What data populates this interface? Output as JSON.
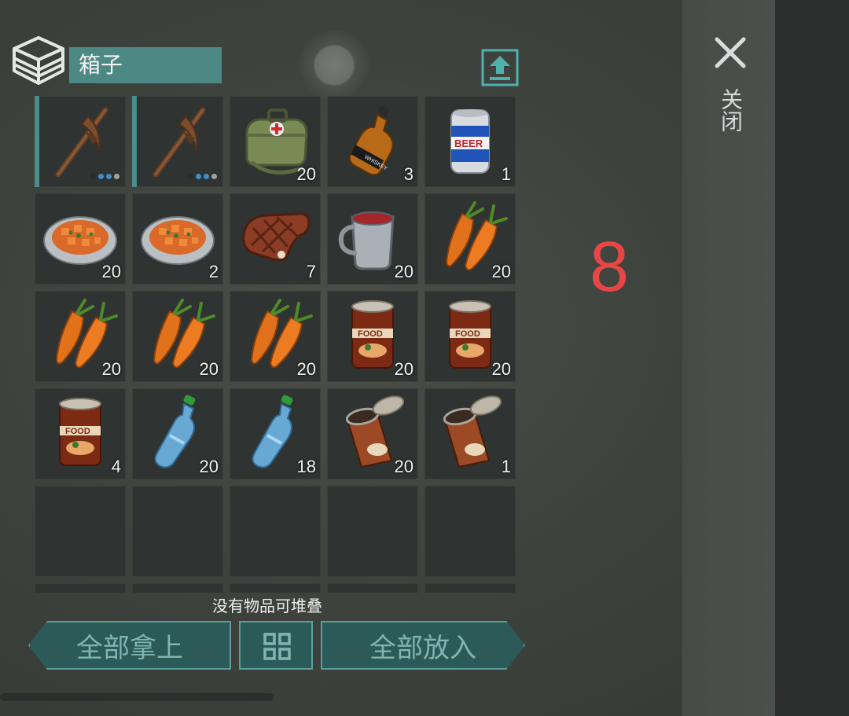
{
  "header": {
    "title": "箱子"
  },
  "close": {
    "label": "关闭"
  },
  "overlay_number": "8",
  "inventory": {
    "slots": [
      {
        "icon": "pickaxe",
        "count": "",
        "durability": 3
      },
      {
        "icon": "pickaxe",
        "count": "",
        "durability": 3
      },
      {
        "icon": "medkit-bag",
        "count": "20"
      },
      {
        "icon": "whiskey-bottle",
        "count": "3"
      },
      {
        "icon": "beer-can",
        "count": "1"
      },
      {
        "icon": "carrot-stew-plate",
        "count": "20"
      },
      {
        "icon": "carrot-stew-plate",
        "count": "2"
      },
      {
        "icon": "steak",
        "count": "7"
      },
      {
        "icon": "tea-mug",
        "count": "20"
      },
      {
        "icon": "carrots",
        "count": "20"
      },
      {
        "icon": "carrots",
        "count": "20"
      },
      {
        "icon": "carrots",
        "count": "20"
      },
      {
        "icon": "carrots",
        "count": "20"
      },
      {
        "icon": "canned-food",
        "count": "20"
      },
      {
        "icon": "canned-food",
        "count": "20"
      },
      {
        "icon": "canned-food",
        "count": "4"
      },
      {
        "icon": "water-bottle",
        "count": "20"
      },
      {
        "icon": "water-bottle",
        "count": "18"
      },
      {
        "icon": "open-can",
        "count": "20"
      },
      {
        "icon": "open-can",
        "count": "1"
      },
      {
        "icon": "",
        "count": ""
      },
      {
        "icon": "",
        "count": ""
      },
      {
        "icon": "",
        "count": ""
      },
      {
        "icon": "",
        "count": ""
      },
      {
        "icon": "",
        "count": ""
      },
      {
        "icon": "",
        "count": ""
      },
      {
        "icon": "",
        "count": ""
      },
      {
        "icon": "",
        "count": ""
      },
      {
        "icon": "",
        "count": ""
      },
      {
        "icon": "",
        "count": ""
      }
    ]
  },
  "status_text": "没有物品可堆叠",
  "buttons": {
    "take_all": "全部拿上",
    "put_all": "全部放入"
  },
  "colors": {
    "accent": "#4e8884",
    "button_fill": "#2c5a58",
    "button_border": "#5b9f9b",
    "overlay_number": "#e84545"
  }
}
